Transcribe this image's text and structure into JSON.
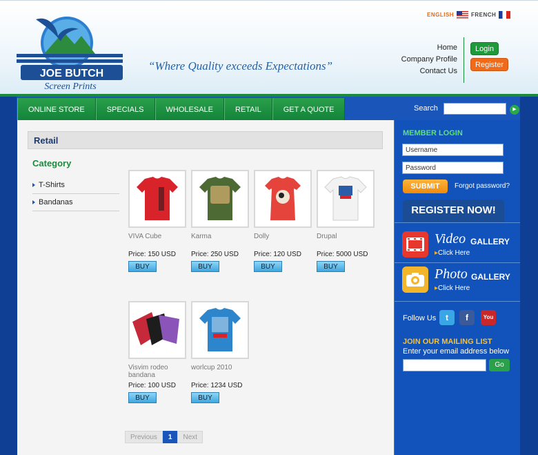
{
  "header": {
    "brand_line1": "JOE BUTCH",
    "brand_line2": "Screen Prints",
    "tagline": "“Where Quality exceeds Expectations”",
    "lang_english": "ENGLISH",
    "lang_french": "FRENCH",
    "links": [
      "Home",
      "Company Profile",
      "Contact Us"
    ],
    "login": "Login",
    "register": "Register"
  },
  "nav": {
    "items": [
      "ONLINE STORE",
      "SPECIALS",
      "WHOLESALE",
      "RETAIL",
      "GET A QUOTE"
    ],
    "search_label": "Search"
  },
  "main": {
    "heading": "Retail",
    "category_title": "Category",
    "categories": [
      "T-Shirts",
      "Bandanas"
    ],
    "products": [
      {
        "name": "VIVA Cube",
        "price": "Price: 150 USD",
        "color": "#d8232b"
      },
      {
        "name": "Karma",
        "price": "Price: 250 USD",
        "color": "#4e6a34"
      },
      {
        "name": "Dolly",
        "price": "Price: 120 USD",
        "color": "#e5443d"
      },
      {
        "name": "Drupal",
        "price": "Price: 5000 USD",
        "color": "#f2f2f2"
      },
      {
        "name": "Visvim rodeo bandana",
        "price": "Price: 100 USD",
        "color": "#c62a3a"
      },
      {
        "name": "worlcup 2010",
        "price": "Price: 1234 USD",
        "color": "#2d86cc"
      }
    ],
    "buy_label": "BUY",
    "pager": {
      "prev": "Previous",
      "current": "1",
      "next": "Next"
    }
  },
  "sidebar": {
    "member_login": "MEMBER LOGIN",
    "username": "Username",
    "password": "Password",
    "submit": "SUBMIT",
    "forgot": "Forgot password?",
    "register_now": "REGISTER NOW!",
    "video_big": "Video",
    "video_small": "GALLERY",
    "photo_big": "Photo",
    "photo_small": "GALLERY",
    "click_here": "Click Here",
    "follow_us": "Follow Us",
    "mailing_title": "JOIN OUR MAILING LIST",
    "mailing_sub": "Enter your email address below",
    "go": "Go"
  }
}
